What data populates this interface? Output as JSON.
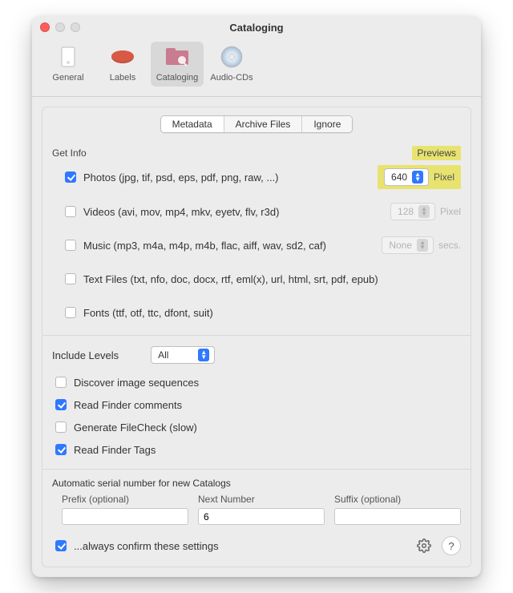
{
  "window": {
    "title": "Cataloging"
  },
  "toolbar": {
    "general": "General",
    "labels": "Labels",
    "cataloging": "Cataloging",
    "audio": "Audio-CDs"
  },
  "tabs": {
    "metadata": "Metadata",
    "archive": "Archive Files",
    "ignore": "Ignore"
  },
  "getinfo": {
    "header": "Get Info",
    "previews_header": "Previews",
    "photos": "Photos (jpg, tif, psd, eps, pdf, png, raw, ...)",
    "photos_value": "640",
    "photos_unit": "Pixel",
    "videos": "Videos (avi, mov, mp4, mkv, eyetv, flv, r3d)",
    "videos_value": "128",
    "videos_unit": "Pixel",
    "music": "Music (mp3, m4a, m4p, m4b, flac, aiff, wav, sd2, caf)",
    "music_value": "None",
    "music_unit": "secs.",
    "text": "Text Files (txt, nfo, doc, docx, rtf, eml(x), url, html, srt, pdf, epub)",
    "fonts": "Fonts (ttf, otf, ttc, dfont, suit)"
  },
  "include": {
    "label": "Include Levels",
    "value": "All",
    "discover": "Discover image sequences",
    "read_comments": "Read Finder comments",
    "filecheck": "Generate FileCheck (slow)",
    "read_tags": "Read Finder Tags"
  },
  "serial": {
    "header": "Automatic serial number for new Catalogs",
    "prefix_label": "Prefix (optional)",
    "prefix_value": "",
    "next_label": "Next Number",
    "next_value": "6",
    "suffix_label": "Suffix (optional)",
    "suffix_value": ""
  },
  "footer": {
    "always_confirm": "...always confirm these settings"
  }
}
